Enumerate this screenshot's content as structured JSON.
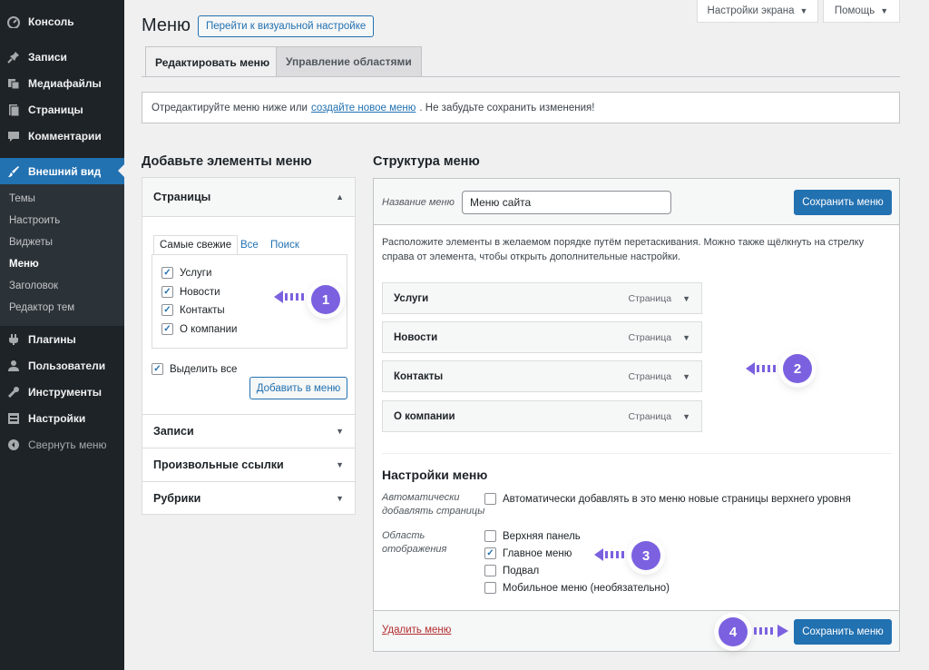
{
  "sidebar": {
    "items": [
      {
        "label": "Консоль",
        "icon": "dashboard-icon"
      },
      {
        "label": "Записи",
        "icon": "pin-icon"
      },
      {
        "label": "Медиафайлы",
        "icon": "media-icon"
      },
      {
        "label": "Страницы",
        "icon": "pages-icon"
      },
      {
        "label": "Комментарии",
        "icon": "comment-icon"
      },
      {
        "label": "Внешний вид",
        "icon": "brush-icon"
      },
      {
        "label": "Плагины",
        "icon": "plugin-icon"
      },
      {
        "label": "Пользователи",
        "icon": "users-icon"
      },
      {
        "label": "Инструменты",
        "icon": "wrench-icon"
      },
      {
        "label": "Настройки",
        "icon": "settings-icon"
      },
      {
        "label": "Свернуть меню",
        "icon": "collapse-icon"
      }
    ],
    "submenu": [
      "Темы",
      "Настроить",
      "Виджеты",
      "Меню",
      "Заголовок",
      "Редактор тем"
    ]
  },
  "screen_meta": {
    "screen_options": "Настройки экрана",
    "help": "Помощь"
  },
  "page": {
    "title": "Меню",
    "visual_button": "Перейти к визуальной настройке",
    "tabs": [
      "Редактировать меню",
      "Управление областями"
    ],
    "notice_before": "Отредактируйте меню ниже или",
    "notice_link": "создайте новое меню",
    "notice_after": ". Не забудьте сохранить изменения!"
  },
  "add_items": {
    "heading": "Добавьте элементы меню",
    "pages_section": "Страницы",
    "inner_tabs": [
      "Самые свежие",
      "Все",
      "Поиск"
    ],
    "pages": [
      "Услуги",
      "Новости",
      "Контакты",
      "О компании"
    ],
    "select_all": "Выделить все",
    "add_button": "Добавить в меню",
    "sections": [
      "Записи",
      "Произвольные ссылки",
      "Рубрики"
    ]
  },
  "structure": {
    "heading": "Структура меню",
    "name_label": "Название меню",
    "name_value": "Меню сайта",
    "save_button": "Сохранить меню",
    "description": "Расположите элементы в желаемом порядке путём перетаскивания. Можно также щёлкнуть на стрелку справа от элемента, чтобы открыть дополнительные настройки.",
    "items": [
      {
        "title": "Услуги",
        "type": "Страница"
      },
      {
        "title": "Новости",
        "type": "Страница"
      },
      {
        "title": "Контакты",
        "type": "Страница"
      },
      {
        "title": "О компании",
        "type": "Страница"
      }
    ]
  },
  "settings": {
    "heading": "Настройки меню",
    "auto_label_1": "Автоматически",
    "auto_label_2": "добавлять страницы",
    "auto_option": "Автоматически добавлять в это меню новые страницы верхнего уровня",
    "location_label_1": "Область",
    "location_label_2": "отображения",
    "locations": [
      {
        "label": "Верхняя панель",
        "checked": false
      },
      {
        "label": "Главное меню",
        "checked": true
      },
      {
        "label": "Подвал",
        "checked": false
      },
      {
        "label": "Мобильное меню (необязательно)",
        "checked": false
      }
    ],
    "delete_link": "Удалить меню",
    "save_button": "Сохранить меню"
  },
  "badges": [
    "1",
    "2",
    "3",
    "4"
  ],
  "colors": {
    "accent": "#2271b1",
    "badge": "#7b61e0",
    "sidebar": "#1d2327"
  }
}
